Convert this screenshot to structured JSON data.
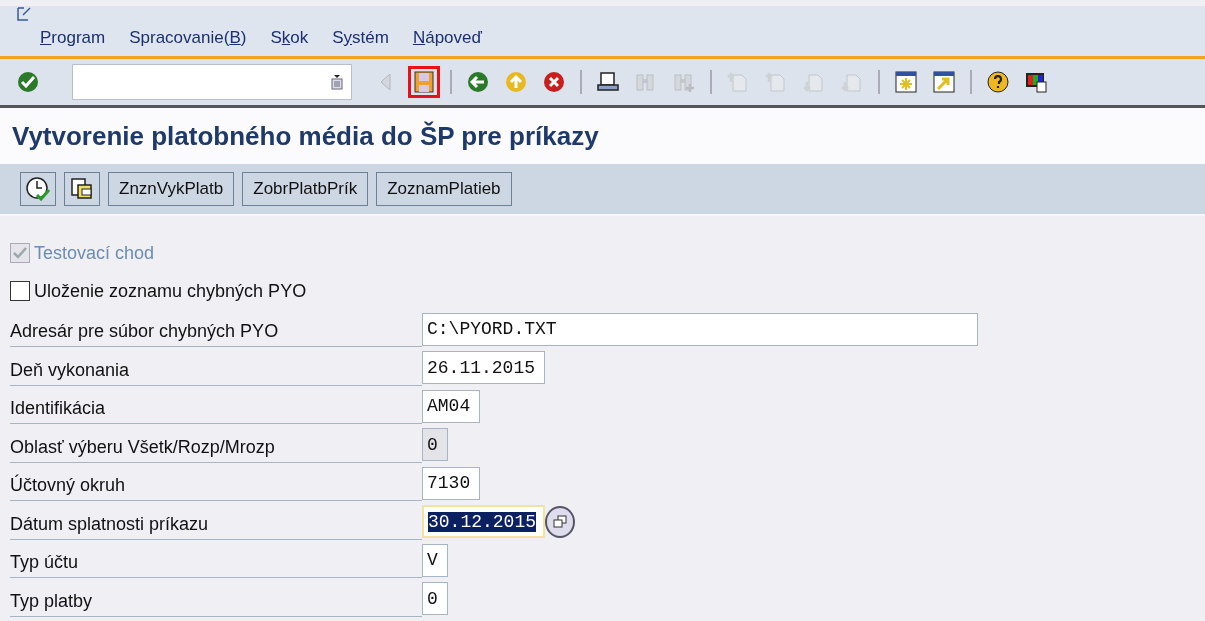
{
  "menu": [
    {
      "underlined": "P",
      "rest": "rogram"
    },
    {
      "before": "Spracovanie(",
      "underlined": "B",
      "rest": ")"
    },
    {
      "before": "S",
      "underlined": "k",
      "rest": "ok"
    },
    {
      "before": "S",
      "underlined": "y",
      "rest": "stém"
    },
    {
      "underlined": "N",
      "rest": "ápoveď"
    }
  ],
  "toolbar": [
    {
      "kind": "enter",
      "disabled": false
    },
    {
      "kind": "command"
    },
    {
      "kind": "triangle",
      "disabled": true
    },
    {
      "kind": "save",
      "disabled": false,
      "highlighted": true
    },
    {
      "kind": "sep"
    },
    {
      "kind": "back",
      "disabled": false
    },
    {
      "kind": "up",
      "disabled": false
    },
    {
      "kind": "cancel",
      "disabled": false
    },
    {
      "kind": "sep"
    },
    {
      "kind": "print",
      "disabled": false
    },
    {
      "kind": "find",
      "disabled": true
    },
    {
      "kind": "findnext",
      "disabled": true
    },
    {
      "kind": "sep"
    },
    {
      "kind": "first",
      "disabled": true
    },
    {
      "kind": "prev",
      "disabled": true
    },
    {
      "kind": "next",
      "disabled": true
    },
    {
      "kind": "last",
      "disabled": true
    },
    {
      "kind": "sep"
    },
    {
      "kind": "newsession",
      "disabled": false
    },
    {
      "kind": "shortcut",
      "disabled": false
    },
    {
      "kind": "sep"
    },
    {
      "kind": "help",
      "disabled": false
    },
    {
      "kind": "layout",
      "disabled": false
    }
  ],
  "title": "Vytvorenie platobného média do ŠP pre príkazy",
  "app_toolbar": [
    {
      "kind": "execute"
    },
    {
      "kind": "variant"
    },
    {
      "kind": "text",
      "label": "ZnznVykPlatb"
    },
    {
      "kind": "text",
      "label": "ZobrPlatbPrík"
    },
    {
      "kind": "text",
      "label": "ZoznamPlatieb"
    }
  ],
  "checkboxes": [
    {
      "label": "Testovací chod",
      "checked": true,
      "disabled": true
    },
    {
      "label": "Uloženie zoznamu chybných PYO",
      "checked": false,
      "disabled": false
    }
  ],
  "fields": [
    {
      "label": "Adresár pre súbor chybných PYO",
      "value": "C:\\PYORD.TXT",
      "disabled": false,
      "focused": false
    },
    {
      "label": "Deň vykonania",
      "value": "26.11.2015",
      "disabled": false,
      "focused": false
    },
    {
      "label": "Identifikácia",
      "value": "AM04",
      "disabled": false,
      "focused": false
    },
    {
      "label": "Oblasť výberu Všetk/Rozp/Mrozp",
      "value": "0",
      "disabled": true,
      "focused": false
    },
    {
      "label": "Účtovný okruh",
      "value": "7130",
      "disabled": false,
      "focused": false
    },
    {
      "label": "Dátum splatnosti príkazu",
      "value": "30.12.2015",
      "disabled": false,
      "focused": true
    },
    {
      "label": "Typ účtu",
      "value": "V",
      "disabled": false,
      "focused": false
    },
    {
      "label": "Typ platby",
      "value": "0",
      "disabled": false,
      "focused": false
    }
  ]
}
